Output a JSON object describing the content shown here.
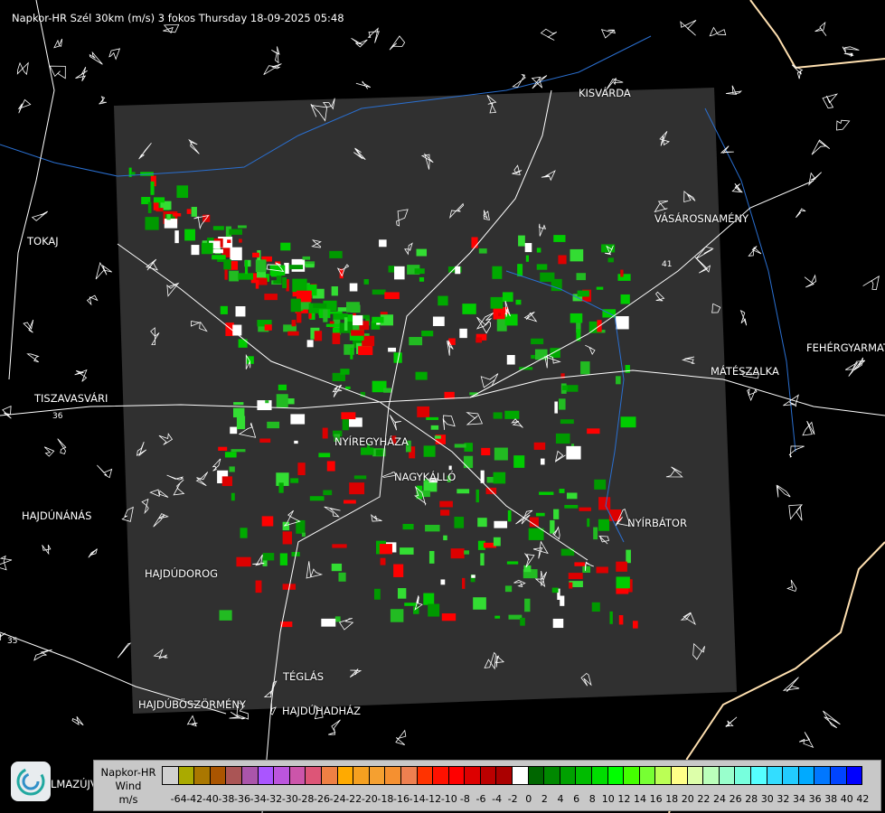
{
  "title": "Napkor-HR Szél 30km (m/s) 3 fokos Thursday 18-09-2025 05:48",
  "cities": [
    {
      "name": "KISVÁRDA"
    },
    {
      "name": "VÁSÁROSNAMÉNY"
    },
    {
      "name": "TOKAJ"
    },
    {
      "name": "FEHÉRGYARMAT"
    },
    {
      "name": "MÁTÉSZALKA"
    },
    {
      "name": "TISZAVASVÁRI"
    },
    {
      "name": "NYÍREGYHÁZA"
    },
    {
      "name": "NAGYKÁLLÓ"
    },
    {
      "name": "HAJDÚNÁNÁS"
    },
    {
      "name": "NYÍRBÁTOR"
    },
    {
      "name": "HAJDÚDOROG"
    },
    {
      "name": "TÉGLÁS"
    },
    {
      "name": "HAJDÚBÖSZÖRMÉNY"
    },
    {
      "name": "HAJDÚHADHÁZ"
    },
    {
      "name": "LMAZÚJVÁROS"
    }
  ],
  "road_numbers": [
    "36",
    "41",
    "35"
  ],
  "legend": {
    "line1": "Napkor-HR",
    "line2": "Wind",
    "line3": "m/s",
    "colors": [
      "#d0d0d0",
      "#aaaa00",
      "#aa7700",
      "#aa5500",
      "#aa5555",
      "#aa55aa",
      "#aa55ff",
      "#bb55dd",
      "#cc55aa",
      "#dd5577",
      "#ee8044",
      "#ffaa00",
      "#f5a020",
      "#f5a030",
      "#f59030",
      "#ee8050",
      "#ff3300",
      "#ff1100",
      "#ff0000",
      "#dd0000",
      "#bb0000",
      "#aa0000",
      "#ffffff",
      "#006600",
      "#008800",
      "#00a000",
      "#00bb00",
      "#00dd00",
      "#00ff00",
      "#44ff00",
      "#77ff33",
      "#bbff55",
      "#ffff88",
      "#ddffaa",
      "#bbffbb",
      "#99ffcc",
      "#77ffdd",
      "#55ffff",
      "#33ddff",
      "#22ccff",
      "#00aaff",
      "#0077ff",
      "#0044ff",
      "#0000ff"
    ],
    "labels": [
      "-64",
      "-42",
      "-40",
      "-38",
      "-36",
      "-34",
      "-32",
      "-30",
      "-28",
      "-26",
      "-24",
      "-22",
      "-20",
      "-18",
      "-16",
      "-14",
      "-12",
      "-10",
      "-8",
      "-6",
      "-4",
      "-2",
      "0",
      "2",
      "4",
      "6",
      "8",
      "10",
      "12",
      "14",
      "16",
      "18",
      "20",
      "22",
      "24",
      "26",
      "28",
      "30",
      "32",
      "34",
      "36",
      "38",
      "40",
      "42"
    ]
  }
}
